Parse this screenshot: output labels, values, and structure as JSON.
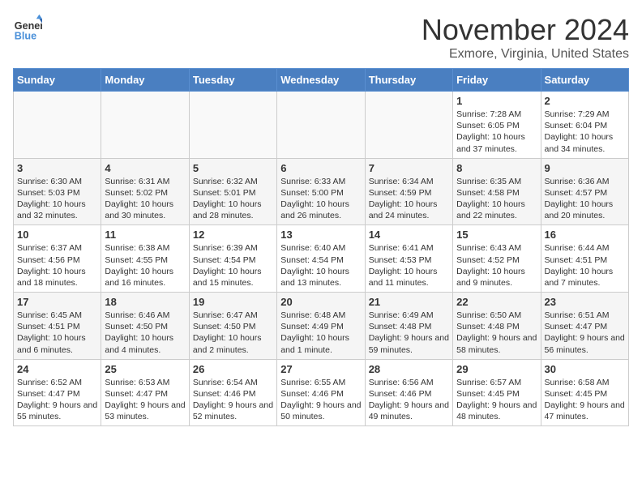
{
  "header": {
    "logo_line1": "General",
    "logo_line2": "Blue",
    "month": "November 2024",
    "location": "Exmore, Virginia, United States"
  },
  "days_of_week": [
    "Sunday",
    "Monday",
    "Tuesday",
    "Wednesday",
    "Thursday",
    "Friday",
    "Saturday"
  ],
  "weeks": [
    [
      {
        "day": "",
        "info": ""
      },
      {
        "day": "",
        "info": ""
      },
      {
        "day": "",
        "info": ""
      },
      {
        "day": "",
        "info": ""
      },
      {
        "day": "",
        "info": ""
      },
      {
        "day": "1",
        "info": "Sunrise: 7:28 AM\nSunset: 6:05 PM\nDaylight: 10 hours and 37 minutes."
      },
      {
        "day": "2",
        "info": "Sunrise: 7:29 AM\nSunset: 6:04 PM\nDaylight: 10 hours and 34 minutes."
      }
    ],
    [
      {
        "day": "3",
        "info": "Sunrise: 6:30 AM\nSunset: 5:03 PM\nDaylight: 10 hours and 32 minutes."
      },
      {
        "day": "4",
        "info": "Sunrise: 6:31 AM\nSunset: 5:02 PM\nDaylight: 10 hours and 30 minutes."
      },
      {
        "day": "5",
        "info": "Sunrise: 6:32 AM\nSunset: 5:01 PM\nDaylight: 10 hours and 28 minutes."
      },
      {
        "day": "6",
        "info": "Sunrise: 6:33 AM\nSunset: 5:00 PM\nDaylight: 10 hours and 26 minutes."
      },
      {
        "day": "7",
        "info": "Sunrise: 6:34 AM\nSunset: 4:59 PM\nDaylight: 10 hours and 24 minutes."
      },
      {
        "day": "8",
        "info": "Sunrise: 6:35 AM\nSunset: 4:58 PM\nDaylight: 10 hours and 22 minutes."
      },
      {
        "day": "9",
        "info": "Sunrise: 6:36 AM\nSunset: 4:57 PM\nDaylight: 10 hours and 20 minutes."
      }
    ],
    [
      {
        "day": "10",
        "info": "Sunrise: 6:37 AM\nSunset: 4:56 PM\nDaylight: 10 hours and 18 minutes."
      },
      {
        "day": "11",
        "info": "Sunrise: 6:38 AM\nSunset: 4:55 PM\nDaylight: 10 hours and 16 minutes."
      },
      {
        "day": "12",
        "info": "Sunrise: 6:39 AM\nSunset: 4:54 PM\nDaylight: 10 hours and 15 minutes."
      },
      {
        "day": "13",
        "info": "Sunrise: 6:40 AM\nSunset: 4:54 PM\nDaylight: 10 hours and 13 minutes."
      },
      {
        "day": "14",
        "info": "Sunrise: 6:41 AM\nSunset: 4:53 PM\nDaylight: 10 hours and 11 minutes."
      },
      {
        "day": "15",
        "info": "Sunrise: 6:43 AM\nSunset: 4:52 PM\nDaylight: 10 hours and 9 minutes."
      },
      {
        "day": "16",
        "info": "Sunrise: 6:44 AM\nSunset: 4:51 PM\nDaylight: 10 hours and 7 minutes."
      }
    ],
    [
      {
        "day": "17",
        "info": "Sunrise: 6:45 AM\nSunset: 4:51 PM\nDaylight: 10 hours and 6 minutes."
      },
      {
        "day": "18",
        "info": "Sunrise: 6:46 AM\nSunset: 4:50 PM\nDaylight: 10 hours and 4 minutes."
      },
      {
        "day": "19",
        "info": "Sunrise: 6:47 AM\nSunset: 4:50 PM\nDaylight: 10 hours and 2 minutes."
      },
      {
        "day": "20",
        "info": "Sunrise: 6:48 AM\nSunset: 4:49 PM\nDaylight: 10 hours and 1 minute."
      },
      {
        "day": "21",
        "info": "Sunrise: 6:49 AM\nSunset: 4:48 PM\nDaylight: 9 hours and 59 minutes."
      },
      {
        "day": "22",
        "info": "Sunrise: 6:50 AM\nSunset: 4:48 PM\nDaylight: 9 hours and 58 minutes."
      },
      {
        "day": "23",
        "info": "Sunrise: 6:51 AM\nSunset: 4:47 PM\nDaylight: 9 hours and 56 minutes."
      }
    ],
    [
      {
        "day": "24",
        "info": "Sunrise: 6:52 AM\nSunset: 4:47 PM\nDaylight: 9 hours and 55 minutes."
      },
      {
        "day": "25",
        "info": "Sunrise: 6:53 AM\nSunset: 4:47 PM\nDaylight: 9 hours and 53 minutes."
      },
      {
        "day": "26",
        "info": "Sunrise: 6:54 AM\nSunset: 4:46 PM\nDaylight: 9 hours and 52 minutes."
      },
      {
        "day": "27",
        "info": "Sunrise: 6:55 AM\nSunset: 4:46 PM\nDaylight: 9 hours and 50 minutes."
      },
      {
        "day": "28",
        "info": "Sunrise: 6:56 AM\nSunset: 4:46 PM\nDaylight: 9 hours and 49 minutes."
      },
      {
        "day": "29",
        "info": "Sunrise: 6:57 AM\nSunset: 4:45 PM\nDaylight: 9 hours and 48 minutes."
      },
      {
        "day": "30",
        "info": "Sunrise: 6:58 AM\nSunset: 4:45 PM\nDaylight: 9 hours and 47 minutes."
      }
    ]
  ]
}
